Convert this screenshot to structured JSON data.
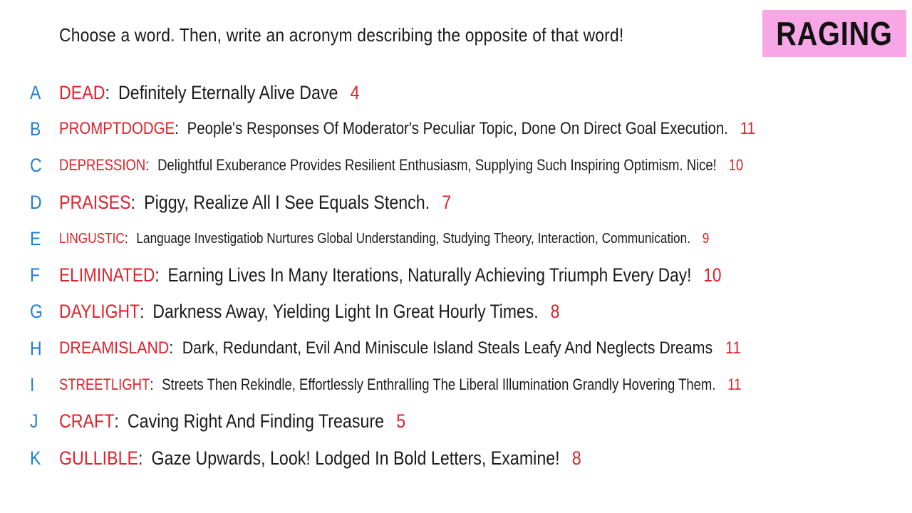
{
  "header": {
    "prompt": "Choose a word. Then, write an acronym describing the opposite of that word!",
    "badge": "RAGING"
  },
  "rows": [
    {
      "letter": "A",
      "word": "DEAD",
      "phrase": "Definitely Eternally Alive Dave",
      "count": "4"
    },
    {
      "letter": "B",
      "word": "PROMPTDODGE",
      "phrase": "People's Responses Of Moderator's Peculiar Topic, Done On Direct Goal Execution.",
      "count": "11"
    },
    {
      "letter": "C",
      "word": "DEPRESSION",
      "phrase": "Delightful Exuberance Provides Resilient Enthusiasm, Supplying Such Inspiring Optimism. Nice!",
      "count": "10"
    },
    {
      "letter": "D",
      "word": "PRAISES",
      "phrase": "Piggy, Realize All I See Equals Stench.",
      "count": "7"
    },
    {
      "letter": "E",
      "word": "LINGUSTIC",
      "phrase": "Language Investigatiob Nurtures Global Understanding, Studying Theory, Interaction, Communication.",
      "count": "9"
    },
    {
      "letter": "F",
      "word": "ELIMINATED",
      "phrase": "Earning Lives In Many Iterations, Naturally Achieving Triumph Every Day!",
      "count": "10"
    },
    {
      "letter": "G",
      "word": "DAYLIGHT",
      "phrase": "Darkness Away, Yielding Light In Great Hourly Times.",
      "count": "8"
    },
    {
      "letter": "H",
      "word": "DREAMISLAND",
      "phrase": "Dark, Redundant, Evil And Miniscule Island Steals Leafy And Neglects Dreams",
      "count": "11"
    },
    {
      "letter": "I",
      "word": "STREETLIGHT",
      "phrase": "Streets Then Rekindle, Effortlessly Enthralling The Liberal Illumination Grandly Hovering Them.",
      "count": "11"
    },
    {
      "letter": "J",
      "word": "CRAFT",
      "phrase": "Caving Right And Finding Treasure",
      "count": "5"
    },
    {
      "letter": "K",
      "word": "GULLIBLE",
      "phrase": "Gaze Upwards, Look! Lodged In Bold Letters, Examine!",
      "count": "8"
    }
  ],
  "colors": {
    "letter": "#1f7fd6",
    "word": "#e0202a",
    "count": "#e0202a",
    "badge_bg": "#f7a7e6"
  }
}
